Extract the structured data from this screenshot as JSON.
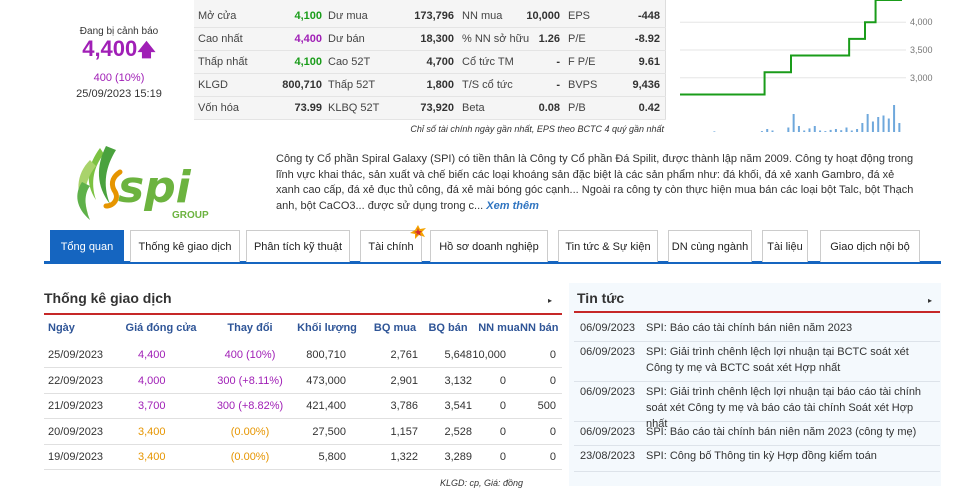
{
  "price": {
    "warning": "Đang bị cảnh báo",
    "value": "4,400",
    "arrow": "🡅",
    "change": "400 (10%)",
    "timestamp": "25/09/2023 15:19"
  },
  "stats": {
    "rows": [
      [
        {
          "l": "Mở cửa",
          "v": "4,100",
          "c": "green"
        },
        {
          "l": "Dư mua",
          "v": "173,796"
        },
        {
          "l": "NN mua",
          "v": "10,000"
        },
        {
          "l": "EPS",
          "v": "-448"
        }
      ],
      [
        {
          "l": "Cao nhất",
          "v": "4,400",
          "c": "purple"
        },
        {
          "l": "Dư bán",
          "v": "18,300"
        },
        {
          "l": "% NN sở hữu",
          "v": "1.26"
        },
        {
          "l": "P/E",
          "v": "-8.92"
        }
      ],
      [
        {
          "l": "Thấp nhất",
          "v": "4,100",
          "c": "green"
        },
        {
          "l": "Cao 52T",
          "v": "4,700"
        },
        {
          "l": "Cổ tức TM",
          "v": "-"
        },
        {
          "l": "F P/E",
          "v": "9.61"
        }
      ],
      [
        {
          "l": "KLGD",
          "v": "800,710"
        },
        {
          "l": "Thấp 52T",
          "v": "1,800"
        },
        {
          "l": "T/S cổ tức",
          "v": "-"
        },
        {
          "l": "BVPS",
          "v": "9,436"
        }
      ],
      [
        {
          "l": "Vốn hóa",
          "v": "73.99"
        },
        {
          "l": "KLBQ 52T",
          "v": "73,920"
        },
        {
          "l": "Beta",
          "v": "0.08"
        },
        {
          "l": "P/B",
          "v": "0.42"
        }
      ]
    ],
    "note": "Chỉ số tài chính ngày gần nhất, EPS theo BCTC 4 quý gần nhất"
  },
  "mini_chart": {
    "y_ticks": [
      "4,000",
      "3,500",
      "3,000"
    ],
    "line_color": "#1a9c1a",
    "volume_color": "#6fa8dc",
    "ylim": [
      2600,
      4400
    ],
    "prices": [
      2700,
      2700,
      2700,
      2700,
      2700,
      2700,
      2700,
      2700,
      2700,
      2700,
      2700,
      2700,
      2700,
      2700,
      2700,
      2700,
      3100,
      3100,
      3100,
      3100,
      3100,
      3400,
      3400,
      3400,
      3400,
      3400,
      3400,
      3400,
      3400,
      3400,
      3400,
      3400,
      3700,
      3700,
      3700,
      4000,
      4000,
      4400,
      4400,
      4400,
      4400,
      4400
    ],
    "volumes": [
      0.0,
      0.0,
      0.0,
      0.0,
      0.0,
      0.0,
      0.02,
      0.0,
      0.0,
      0.0,
      0.0,
      0.0,
      0.0,
      0.0,
      0.0,
      0.03,
      0.1,
      0.05,
      0.0,
      0.0,
      0.15,
      0.6,
      0.2,
      0.05,
      0.12,
      0.2,
      0.05,
      0.03,
      0.07,
      0.1,
      0.06,
      0.15,
      0.05,
      0.1,
      0.3,
      0.6,
      0.35,
      0.5,
      0.55,
      0.45,
      0.9,
      0.3
    ]
  },
  "company": {
    "logo_text": "spi",
    "logo_sub": "GROUP",
    "description": "Công ty Cổ phần Spiral Galaxy (SPI) có tiền thân là Công ty Cổ phần Đá Spilit, được thành lập năm 2009. Công ty hoạt động trong lĩnh vực khai thác, sản xuất và chế biến các loại khoáng sản đặc biệt là các sản phẩm như: đá khối, đá xẻ xanh Gambro, đá xẻ xanh cao cấp, đá xẻ đục thủ công, đá xẻ mài bóng góc cạnh... Ngoài ra công ty còn thực hiện mua bán các loại bột Talc, bột Thạch anh, bột CaCO3... được sử dụng trong c...",
    "more": "Xem thêm"
  },
  "tabs": [
    "Tổng quan",
    "Thống kê giao dịch",
    "Phân tích kỹ thuật",
    "Tài chính",
    "Hồ sơ doanh nghiệp",
    "Tin tức & Sự kiện",
    "DN cùng ngành",
    "Tài liệu",
    "Giao dịch nội bộ"
  ],
  "trading": {
    "title": "Thống kê giao dịch",
    "arrow": "▸",
    "headers": [
      "Ngày",
      "Giá đóng cửa",
      "Thay đổi",
      "Khối lượng",
      "BQ mua",
      "BQ bán",
      "NN mua",
      "NN bán"
    ],
    "rows": [
      {
        "date": "25/09/2023",
        "close": "4,400",
        "change": "400 (10%)",
        "vol": "800,710",
        "bqm": "2,761",
        "bqb": "5,648",
        "nnm": "10,000",
        "nnb": "0",
        "cc": "purple"
      },
      {
        "date": "22/09/2023",
        "close": "4,000",
        "change": "300 (+8.11%)",
        "vol": "473,000",
        "bqm": "2,901",
        "bqb": "3,132",
        "nnm": "0",
        "nnb": "0",
        "cc": "purple"
      },
      {
        "date": "21/09/2023",
        "close": "3,700",
        "change": "300 (+8.82%)",
        "vol": "421,400",
        "bqm": "3,786",
        "bqb": "3,541",
        "nnm": "0",
        "nnb": "500",
        "cc": "purple"
      },
      {
        "date": "20/09/2023",
        "close": "3,400",
        "change": "(0.00%)",
        "vol": "27,500",
        "bqm": "1,157",
        "bqb": "2,528",
        "nnm": "0",
        "nnb": "0",
        "cc": "orange"
      },
      {
        "date": "19/09/2023",
        "close": "3,400",
        "change": "(0.00%)",
        "vol": "5,800",
        "bqm": "1,322",
        "bqb": "3,289",
        "nnm": "0",
        "nnb": "0",
        "cc": "orange"
      }
    ],
    "footnote": "KLGD: cp, Giá: đồng"
  },
  "news": {
    "title": "Tin tức",
    "arrow": "▸",
    "items": [
      {
        "date": "06/09/2023",
        "text": "SPI: Báo cáo tài chính bán niên năm 2023"
      },
      {
        "date": "06/09/2023",
        "text": "SPI: Giải trình chênh lệch lợi nhuận tại BCTC soát xét Công ty mẹ và BCTC soát xét Hợp nhất"
      },
      {
        "date": "06/09/2023",
        "text": "SPI: Giải trình chênh lệch lợi nhuận tại báo cáo tài chính soát xét Công ty mẹ và báo cáo tài chính Soát xét Hợp nhất"
      },
      {
        "date": "06/09/2023",
        "text": "SPI: Báo cáo tài chính bán niên năm 2023 (công ty mẹ)"
      },
      {
        "date": "23/08/2023",
        "text": "SPI: Công bố Thông tin kỳ Hợp đồng kiểm toán"
      }
    ]
  }
}
